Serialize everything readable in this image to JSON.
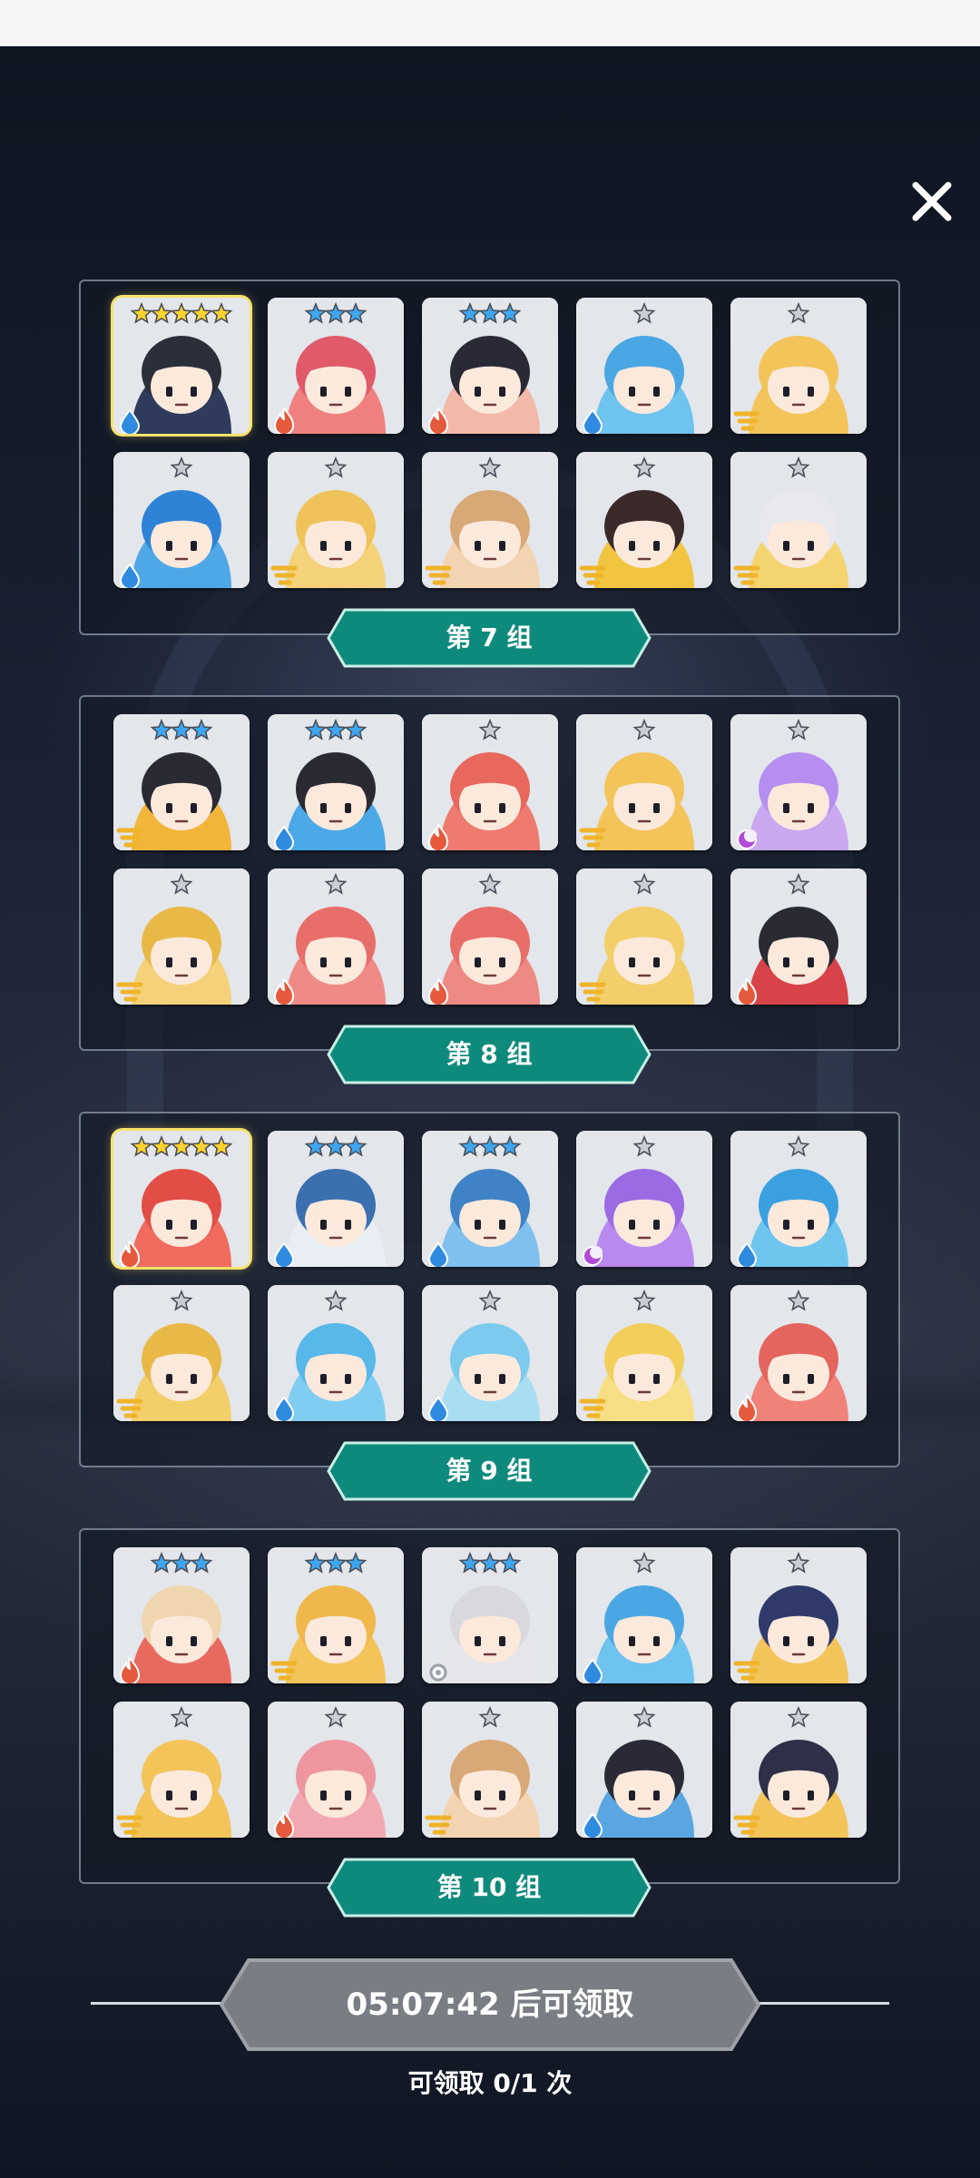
{
  "colors": {
    "group_label_bg": "#0e8a7c",
    "group_label_border": "#c9efe6",
    "claim_button_bg": "#7a7d83",
    "fire": "#e65a3c",
    "water": "#2f8be0",
    "wind": "#f0b42a",
    "dark": "#b24ad8",
    "light": "#9aa0a8"
  },
  "close_icon": "close-icon",
  "groups": [
    {
      "label": "第 7 组",
      "cards": [
        {
          "stars": 5,
          "rarity": "gold",
          "element": "water",
          "color": "#2f3b5c",
          "hair": "#2b2f3a"
        },
        {
          "stars": 3,
          "rarity": "blue",
          "element": "fire",
          "color": "#f08080",
          "hair": "#e05a6a"
        },
        {
          "stars": 3,
          "rarity": "blue",
          "element": "fire",
          "color": "#f2b8a8",
          "hair": "#2a2a36"
        },
        {
          "stars": 1,
          "rarity": "silver",
          "element": "water",
          "color": "#6ec3ef",
          "hair": "#4aa7e3"
        },
        {
          "stars": 1,
          "rarity": "silver",
          "element": "wind",
          "color": "#f3c45a",
          "hair": "#f3c45a"
        },
        {
          "stars": 1,
          "rarity": "silver",
          "element": "water",
          "color": "#4fa8e6",
          "hair": "#2f83d6"
        },
        {
          "stars": 1,
          "rarity": "silver",
          "element": "wind",
          "color": "#f4d27a",
          "hair": "#f0c35a"
        },
        {
          "stars": 1,
          "rarity": "silver",
          "element": "wind",
          "color": "#f2d3b2",
          "hair": "#d9a877"
        },
        {
          "stars": 1,
          "rarity": "silver",
          "element": "wind",
          "color": "#f2c540",
          "hair": "#3a2a2a"
        },
        {
          "stars": 1,
          "rarity": "silver",
          "element": "wind",
          "color": "#f4d46e",
          "hair": "#e8e8ee"
        }
      ]
    },
    {
      "label": "第 8 组",
      "cards": [
        {
          "stars": 3,
          "rarity": "blue",
          "element": "wind",
          "color": "#f3b43a",
          "hair": "#2a2a33"
        },
        {
          "stars": 3,
          "rarity": "blue",
          "element": "water",
          "color": "#4aa9e6",
          "hair": "#2a2a33"
        },
        {
          "stars": 1,
          "rarity": "silver",
          "element": "fire",
          "color": "#ef7a70",
          "hair": "#e8685e"
        },
        {
          "stars": 1,
          "rarity": "silver",
          "element": "wind",
          "color": "#f3c45a",
          "hair": "#f3c45a"
        },
        {
          "stars": 1,
          "rarity": "silver",
          "element": "dark",
          "color": "#c9a8f0",
          "hair": "#b68ef0"
        },
        {
          "stars": 1,
          "rarity": "silver",
          "element": "wind",
          "color": "#f5d27a",
          "hair": "#e9b948"
        },
        {
          "stars": 1,
          "rarity": "silver",
          "element": "fire",
          "color": "#f08a86",
          "hair": "#e86e6a"
        },
        {
          "stars": 1,
          "rarity": "silver",
          "element": "fire",
          "color": "#ee8a84",
          "hair": "#e86e6a"
        },
        {
          "stars": 1,
          "rarity": "silver",
          "element": "wind",
          "color": "#f3cf6a",
          "hair": "#f3cf6a"
        },
        {
          "stars": 1,
          "rarity": "silver",
          "element": "fire",
          "color": "#d8434a",
          "hair": "#2a2a33"
        }
      ]
    },
    {
      "label": "第 9 组",
      "cards": [
        {
          "stars": 5,
          "rarity": "gold",
          "element": "fire",
          "color": "#f06a5e",
          "hair": "#e24e46"
        },
        {
          "stars": 3,
          "rarity": "blue",
          "element": "water",
          "color": "#e8eef4",
          "hair": "#3b6fb0"
        },
        {
          "stars": 3,
          "rarity": "blue",
          "element": "water",
          "color": "#7fc0ee",
          "hair": "#3f82c6"
        },
        {
          "stars": 1,
          "rarity": "silver",
          "element": "dark",
          "color": "#b889ef",
          "hair": "#9b6be3"
        },
        {
          "stars": 1,
          "rarity": "silver",
          "element": "water",
          "color": "#6ec6ef",
          "hair": "#3aa0e0"
        },
        {
          "stars": 1,
          "rarity": "silver",
          "element": "wind",
          "color": "#f3cf6a",
          "hair": "#e9b948"
        },
        {
          "stars": 1,
          "rarity": "silver",
          "element": "water",
          "color": "#7fcdf0",
          "hair": "#58b8ea"
        },
        {
          "stars": 1,
          "rarity": "silver",
          "element": "water",
          "color": "#a9ddf2",
          "hair": "#7ccbef"
        },
        {
          "stars": 1,
          "rarity": "silver",
          "element": "wind",
          "color": "#f6de84",
          "hair": "#f2cf5a"
        },
        {
          "stars": 1,
          "rarity": "silver",
          "element": "fire",
          "color": "#f0827a",
          "hair": "#e4655d"
        }
      ]
    },
    {
      "label": "第 10 组",
      "cards": [
        {
          "stars": 3,
          "rarity": "blue",
          "element": "fire",
          "color": "#e86a5e",
          "hair": "#f0d6b0"
        },
        {
          "stars": 3,
          "rarity": "blue",
          "element": "wind",
          "color": "#f3c45a",
          "hair": "#f0b84a"
        },
        {
          "stars": 3,
          "rarity": "blue",
          "element": "light",
          "color": "#e6e6ea",
          "hair": "#d8d8de"
        },
        {
          "stars": 1,
          "rarity": "silver",
          "element": "water",
          "color": "#6ec3ef",
          "hair": "#4aa7e3"
        },
        {
          "stars": 1,
          "rarity": "silver",
          "element": "wind",
          "color": "#f3c45a",
          "hair": "#2f3a6a"
        },
        {
          "stars": 1,
          "rarity": "silver",
          "element": "wind",
          "color": "#f3c45a",
          "hair": "#f3c45a"
        },
        {
          "stars": 1,
          "rarity": "silver",
          "element": "fire",
          "color": "#f2a8b0",
          "hair": "#ee96a0"
        },
        {
          "stars": 1,
          "rarity": "silver",
          "element": "wind",
          "color": "#f2d3b2",
          "hair": "#d9a877"
        },
        {
          "stars": 1,
          "rarity": "silver",
          "element": "water",
          "color": "#5aa6e2",
          "hair": "#2a2a36"
        },
        {
          "stars": 1,
          "rarity": "silver",
          "element": "wind",
          "color": "#f3c45a",
          "hair": "#2f2f48"
        }
      ]
    }
  ],
  "claim": {
    "timer_label": "05:07:42 后可领取",
    "count_label": "可领取 0/1 次"
  }
}
